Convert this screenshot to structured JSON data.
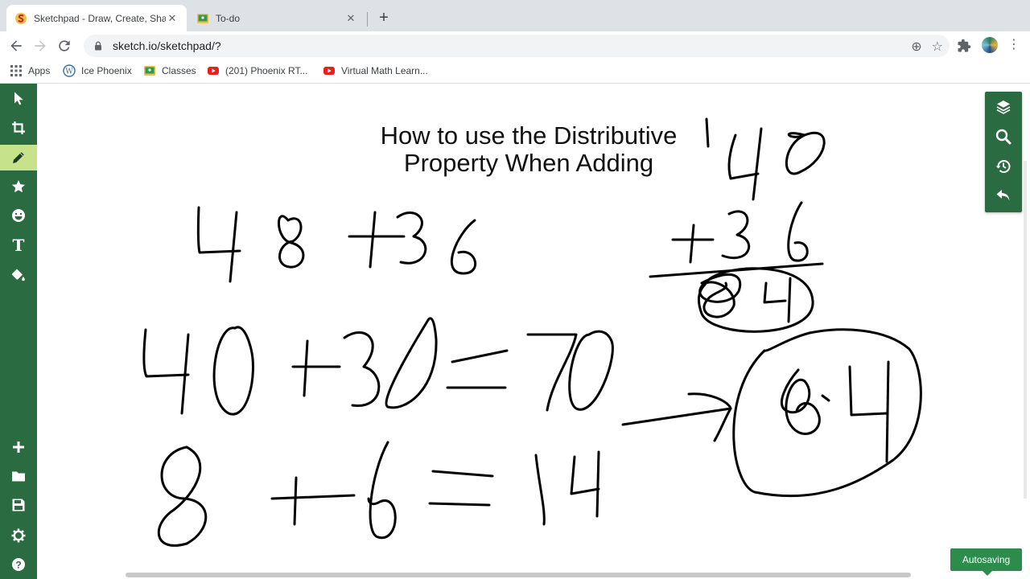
{
  "browser": {
    "tabs": [
      {
        "title": "Sketchpad - Draw, Create, Sha",
        "active": true
      },
      {
        "title": "To-do",
        "active": false
      }
    ],
    "url": "sketch.io/sketchpad/?",
    "bookmarks": [
      {
        "label": "Apps",
        "icon": "apps-grid-icon"
      },
      {
        "label": "Ice Phoenix",
        "icon": "wordpress-icon"
      },
      {
        "label": "Classes",
        "icon": "google-classroom-icon"
      },
      {
        "label": "(201) Phoenix RT...",
        "icon": "youtube-icon"
      },
      {
        "label": "Virtual Math Learn...",
        "icon": "youtube-icon"
      }
    ]
  },
  "sketchpad": {
    "left_tools": [
      {
        "name": "select-tool",
        "icon": "cursor-icon"
      },
      {
        "name": "crop-tool",
        "icon": "crop-icon"
      },
      {
        "name": "pencil-tool",
        "icon": "pencil-icon",
        "active": true
      },
      {
        "name": "stamp-tool",
        "icon": "star-icon"
      },
      {
        "name": "emoji-tool",
        "icon": "emoji-icon"
      },
      {
        "name": "text-tool",
        "icon": "text-icon",
        "glyph": "T"
      },
      {
        "name": "fill-tool",
        "icon": "paint-bucket-icon"
      },
      {
        "name": "add-tool",
        "icon": "plus-icon"
      },
      {
        "name": "open-tool",
        "icon": "folder-icon"
      },
      {
        "name": "save-tool",
        "icon": "floppy-disk-icon"
      },
      {
        "name": "settings-tool",
        "icon": "gear-icon"
      },
      {
        "name": "help-tool",
        "icon": "question-icon"
      }
    ],
    "right_tools": [
      {
        "name": "layers-tool",
        "icon": "layers-icon"
      },
      {
        "name": "zoom-tool",
        "icon": "magnifier-icon"
      },
      {
        "name": "history-tool",
        "icon": "history-icon"
      },
      {
        "name": "undo-tool",
        "icon": "undo-icon"
      }
    ],
    "title_lines": [
      "How to use the Distributive",
      "Property When Adding"
    ],
    "handwriting": {
      "line1": "48+36",
      "line2": "40+30=70",
      "line3": "8+6=14",
      "vertical_top": "148",
      "vertical_addend": "+36",
      "vertical_sum": "84",
      "result": "84"
    },
    "status_toast": "Autosaving"
  },
  "colors": {
    "toolbar_green": "#2b6b42",
    "active_tool": "#c6e38c",
    "toast_green": "#2c8c4c",
    "tabstrip": "#dee1e6"
  }
}
